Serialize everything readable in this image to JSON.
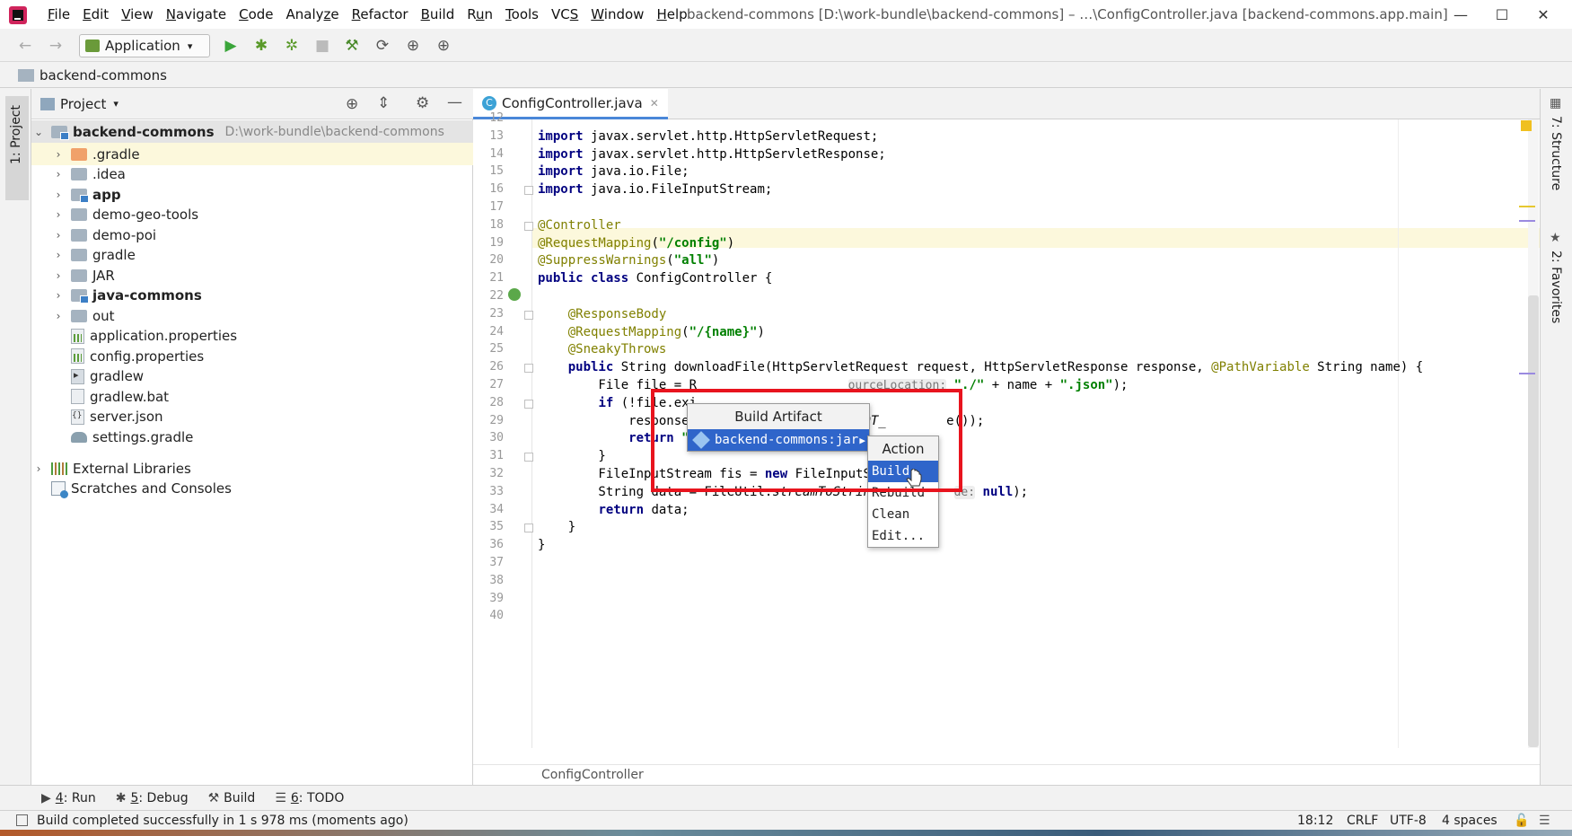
{
  "window": {
    "title": "backend-commons [D:\\work-bundle\\backend-commons] – …\\ConfigController.java [backend-commons.app.main]",
    "minimize": "—",
    "maximize": "☐",
    "close": "✕"
  },
  "menu": [
    {
      "u": "F",
      "rest": "ile"
    },
    {
      "u": "E",
      "rest": "dit"
    },
    {
      "u": "V",
      "rest": "iew"
    },
    {
      "u": "N",
      "rest": "avigate"
    },
    {
      "u": "C",
      "rest": "ode"
    },
    {
      "pre": "Analy",
      "u": "z",
      "rest": "e"
    },
    {
      "u": "R",
      "rest": "efactor"
    },
    {
      "u": "B",
      "rest": "uild"
    },
    {
      "pre": "R",
      "u": "u",
      "rest": "n"
    },
    {
      "u": "T",
      "rest": "ools"
    },
    {
      "pre": "VC",
      "u": "S",
      "rest": ""
    },
    {
      "u": "W",
      "rest": "indow"
    },
    {
      "u": "H",
      "rest": "elp"
    }
  ],
  "toolbar": {
    "run_config": "Application",
    "icons": [
      "back-arrow-icon",
      "forward-arrow-icon",
      "run-icon",
      "debug-icon",
      "coverage-icon",
      "stop-icon",
      "build-hammer-icon",
      "sync-icon",
      "attach-icon",
      "profiler-icon"
    ]
  },
  "breadcrumb": {
    "project": "backend-commons"
  },
  "left_stripe": {
    "project_tab": "1: Project"
  },
  "project_panel": {
    "title": "Project",
    "root": {
      "name": "backend-commons",
      "path": "D:\\work-bundle\\backend-commons"
    },
    "items": [
      {
        "label": ".gradle",
        "kind": "folder-orange",
        "expandable": true
      },
      {
        "label": ".idea",
        "kind": "folder",
        "expandable": true
      },
      {
        "label": "app",
        "kind": "module",
        "expandable": true,
        "bold": true
      },
      {
        "label": "demo-geo-tools",
        "kind": "folder",
        "expandable": true
      },
      {
        "label": "demo-poi",
        "kind": "folder",
        "expandable": true
      },
      {
        "label": "gradle",
        "kind": "folder",
        "expandable": true
      },
      {
        "label": "JAR",
        "kind": "folder",
        "expandable": true
      },
      {
        "label": "java-commons",
        "kind": "module",
        "expandable": true,
        "bold": true
      },
      {
        "label": "out",
        "kind": "folder",
        "expandable": true
      },
      {
        "label": "application.properties",
        "kind": "props"
      },
      {
        "label": "config.properties",
        "kind": "props"
      },
      {
        "label": "gradlew",
        "kind": "term"
      },
      {
        "label": "gradlew.bat",
        "kind": "file"
      },
      {
        "label": "server.json",
        "kind": "json"
      },
      {
        "label": "settings.gradle",
        "kind": "gradle"
      }
    ],
    "external_libraries": "External Libraries",
    "scratches": "Scratches and Consoles"
  },
  "editor": {
    "tab": "ConfigController.java",
    "breadcrumb": "ConfigController",
    "lines": [
      {
        "n": "12",
        "segs": [
          {
            "t": ""
          }
        ]
      },
      {
        "n": "13",
        "segs": [
          {
            "c": "kw",
            "t": "import"
          },
          {
            "t": " javax.servlet.http.HttpServletRequest;"
          }
        ]
      },
      {
        "n": "14",
        "segs": [
          {
            "c": "kw",
            "t": "import"
          },
          {
            "t": " javax.servlet.http.HttpServletResponse;"
          }
        ]
      },
      {
        "n": "15",
        "segs": [
          {
            "c": "kw",
            "t": "import"
          },
          {
            "t": " java.io.File;"
          }
        ]
      },
      {
        "n": "16",
        "segs": [
          {
            "c": "kw",
            "t": "import"
          },
          {
            "t": " java.io.FileInputStream;"
          }
        ]
      },
      {
        "n": "17",
        "segs": [
          {
            "t": ""
          }
        ]
      },
      {
        "n": "18",
        "segs": [
          {
            "c": "ann",
            "t": "@Controller"
          }
        ]
      },
      {
        "n": "19",
        "segs": [
          {
            "c": "ann",
            "t": "@RequestMapping"
          },
          {
            "t": "("
          },
          {
            "c": "str",
            "t": "\"/config\""
          },
          {
            "t": ")"
          }
        ]
      },
      {
        "n": "20",
        "segs": [
          {
            "c": "ann",
            "t": "@SuppressWarnings"
          },
          {
            "t": "("
          },
          {
            "c": "str",
            "t": "\"all\""
          },
          {
            "t": ")"
          }
        ]
      },
      {
        "n": "21",
        "segs": [
          {
            "c": "kw",
            "t": "public class"
          },
          {
            "t": " ConfigController {"
          }
        ]
      },
      {
        "n": "22",
        "segs": [
          {
            "t": ""
          }
        ]
      },
      {
        "n": "23",
        "segs": [
          {
            "t": "    "
          },
          {
            "c": "ann",
            "t": "@ResponseBody"
          }
        ]
      },
      {
        "n": "24",
        "segs": [
          {
            "t": "    "
          },
          {
            "c": "ann",
            "t": "@RequestMapping"
          },
          {
            "t": "("
          },
          {
            "c": "str",
            "t": "\"/{name}\""
          },
          {
            "t": ")"
          }
        ]
      },
      {
        "n": "25",
        "segs": [
          {
            "t": "    "
          },
          {
            "c": "ann",
            "t": "@SneakyThrows"
          }
        ]
      },
      {
        "n": "26",
        "segs": [
          {
            "t": "    "
          },
          {
            "c": "kw",
            "t": "public"
          },
          {
            "t": " String downloadFile(HttpServletRequest request, HttpServletResponse response, "
          },
          {
            "c": "ann",
            "t": "@PathVariable"
          },
          {
            "t": " String name) {"
          }
        ]
      },
      {
        "n": "27",
        "segs": [
          {
            "t": "        File file = R                    "
          },
          {
            "c": "hint",
            "t": "ourceLocation:"
          },
          {
            "t": " "
          },
          {
            "c": "str",
            "t": "\"./\""
          },
          {
            "t": " + name + "
          },
          {
            "c": "str",
            "t": "\".json\""
          },
          {
            "t": ");"
          }
        ]
      },
      {
        "n": "28",
        "segs": [
          {
            "t": "        "
          },
          {
            "c": "kw",
            "t": "if"
          },
          {
            "t": " (!file.exi"
          }
        ]
      },
      {
        "n": "29",
        "segs": [
          {
            "t": "            response.setStatus(HttpStatus."
          },
          {
            "c": "it",
            "t": "NOT_"
          },
          {
            "t": "        e());"
          }
        ]
      },
      {
        "n": "30",
        "segs": [
          {
            "t": "            "
          },
          {
            "c": "kw",
            "t": "return"
          },
          {
            "t": " "
          },
          {
            "c": "str",
            "t": "\"File Not Found\""
          },
          {
            "t": ";"
          }
        ]
      },
      {
        "n": "31",
        "segs": [
          {
            "t": "        }"
          }
        ]
      },
      {
        "n": "32",
        "segs": [
          {
            "t": "        FileInputStream fis = "
          },
          {
            "c": "kw",
            "t": "new"
          },
          {
            "t": " FileInputStr"
          }
        ]
      },
      {
        "n": "33",
        "segs": [
          {
            "t": "        String data = FileUtil."
          },
          {
            "c": "it",
            "t": "streamToString"
          },
          {
            "t": "(         "
          },
          {
            "c": "hint",
            "t": "de:"
          },
          {
            "t": " "
          },
          {
            "c": "kw",
            "t": "null"
          },
          {
            "t": ");"
          }
        ]
      },
      {
        "n": "34",
        "segs": [
          {
            "t": "        "
          },
          {
            "c": "kw",
            "t": "return"
          },
          {
            "t": " data;"
          }
        ]
      },
      {
        "n": "35",
        "segs": [
          {
            "t": "    }"
          }
        ]
      },
      {
        "n": "36",
        "segs": [
          {
            "t": "}"
          }
        ]
      },
      {
        "n": "37",
        "segs": [
          {
            "t": ""
          }
        ]
      },
      {
        "n": "38",
        "segs": [
          {
            "t": ""
          }
        ]
      },
      {
        "n": "39",
        "segs": [
          {
            "t": ""
          }
        ]
      },
      {
        "n": "40",
        "segs": [
          {
            "t": ""
          }
        ]
      }
    ]
  },
  "popup_artifact": {
    "title": "Build Artifact",
    "item": "backend-commons:jar"
  },
  "popup_action": {
    "title": "Action",
    "items": [
      "Build",
      "Rebuild",
      "Clean",
      "Edit..."
    ],
    "selected": 0
  },
  "right_stripe": {
    "structure": "7: Structure",
    "favorites": "2: Favorites"
  },
  "bottom_tabs": [
    {
      "num": "4",
      "label": ": Run",
      "icon": "run-icon"
    },
    {
      "num": "5",
      "label": ": Debug",
      "icon": "debug-icon"
    },
    {
      "num": "",
      "label": "Build",
      "icon": "build-hammer-icon"
    },
    {
      "num": "6",
      "label": ": TODO",
      "icon": "todo-list-icon"
    }
  ],
  "statusbar": {
    "message": "Build completed successfully in 1 s 978 ms (moments ago)",
    "position": "18:12",
    "line_sep": "CRLF",
    "encoding": "UTF-8",
    "indent": "4 spaces"
  },
  "colors": {
    "accent": "#2f65ca",
    "highlight_box": "#e8141e",
    "caret_row": "#fcf8dc"
  }
}
